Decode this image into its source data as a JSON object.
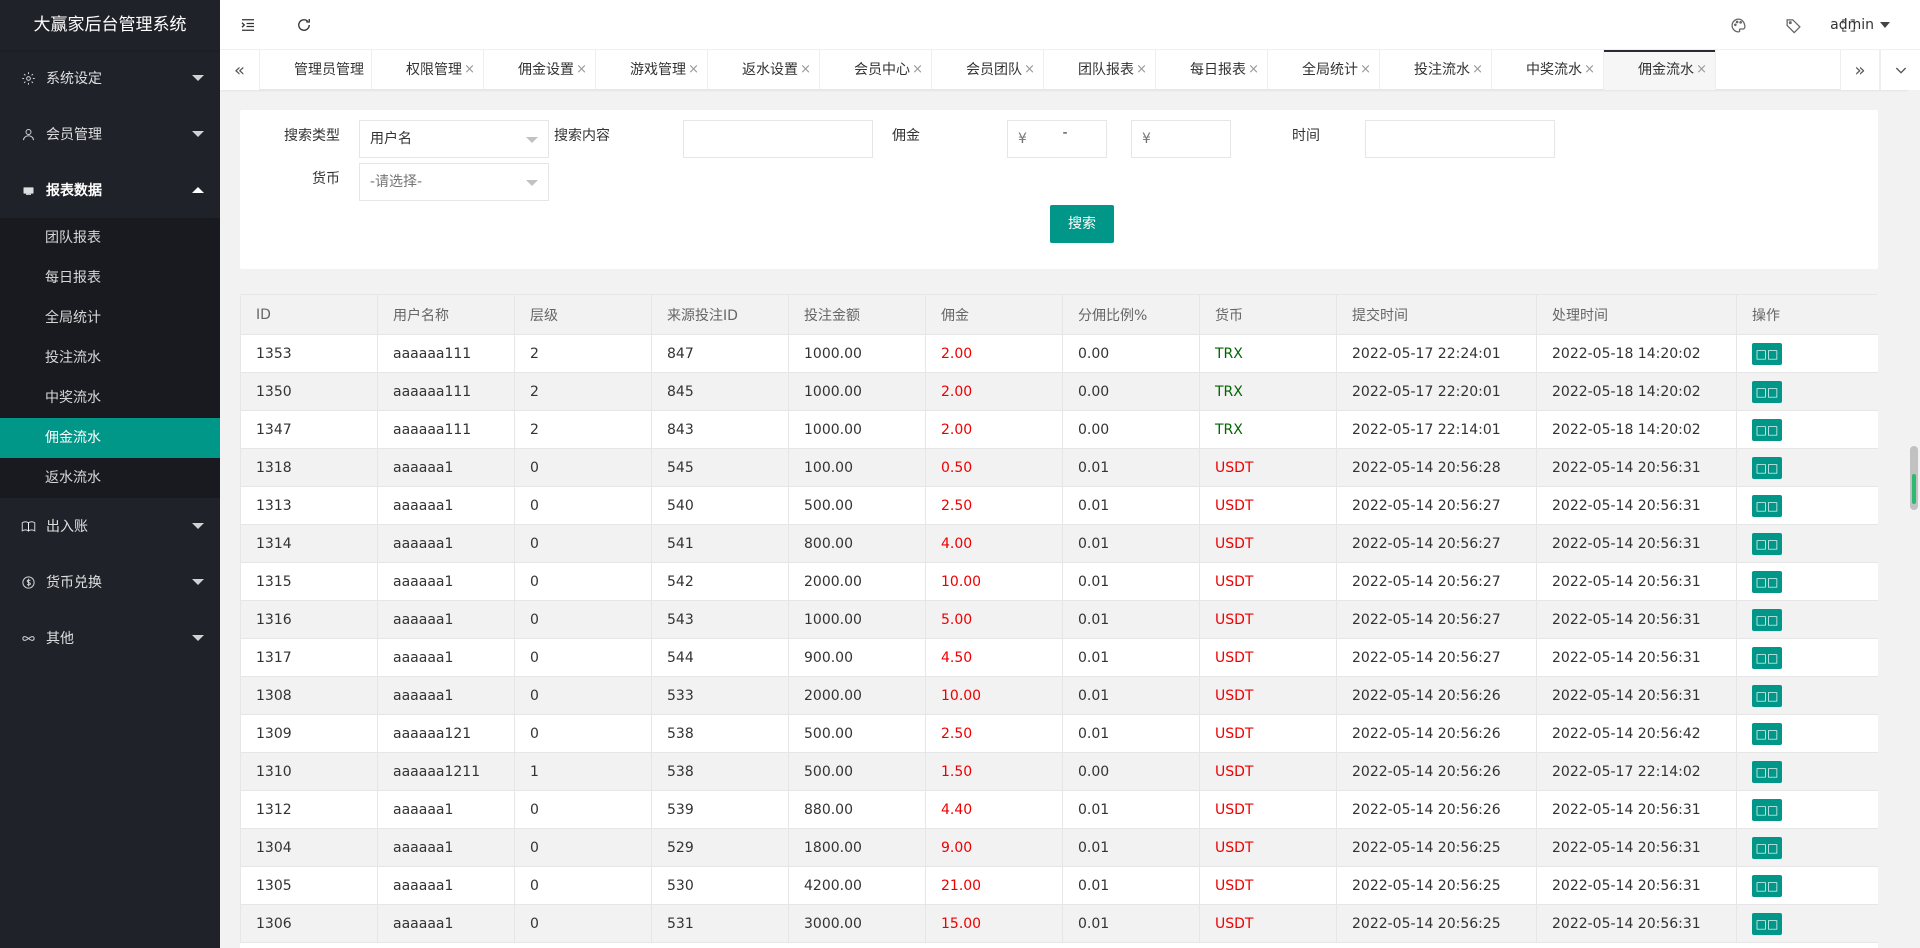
{
  "app": {
    "title": "大赢家后台管理系统"
  },
  "sidebar": {
    "items": [
      {
        "label": "系统设定",
        "icon": "gear-icon"
      },
      {
        "label": "会员管理",
        "icon": "user-icon"
      },
      {
        "label": "报表数据",
        "icon": "report-icon"
      },
      {
        "label": "出入账",
        "icon": "book-icon"
      },
      {
        "label": "货币兑换",
        "icon": "dollar-icon"
      },
      {
        "label": "其他",
        "icon": "infinity-icon"
      }
    ],
    "report_children": [
      "团队报表",
      "每日报表",
      "全局统计",
      "投注流水",
      "中奖流水",
      "佣金流水",
      "返水流水"
    ]
  },
  "header": {
    "user": "admin"
  },
  "tabs": [
    "管理员管理",
    "权限管理",
    "佣金设置",
    "游戏管理",
    "返水设置",
    "会员中心",
    "会员团队",
    "团队报表",
    "每日报表",
    "全局统计",
    "投注流水",
    "中奖流水",
    "佣金流水"
  ],
  "search": {
    "type_label": "搜索类型",
    "type_value": "用户名",
    "content_label": "搜索内容",
    "commission_label": "佣金",
    "currency_symbol": "¥",
    "dash": "-",
    "time_label": "时间",
    "currency_label": "货币",
    "currency_placeholder": "-请选择-",
    "button": "搜索"
  },
  "table": {
    "headers": [
      "ID",
      "用户名称",
      "层级",
      "来源投注ID",
      "投注金额",
      "佣金",
      "分佣比例%",
      "货币",
      "提交时间",
      "处理时间",
      "操作"
    ],
    "op_label": "□□",
    "rows": [
      [
        "1353",
        "aaaaaa111",
        "2",
        "847",
        "1000.00",
        "2.00",
        "0.00",
        "TRX",
        "2022-05-17 22:24:01",
        "2022-05-18 14:20:02"
      ],
      [
        "1350",
        "aaaaaa111",
        "2",
        "845",
        "1000.00",
        "2.00",
        "0.00",
        "TRX",
        "2022-05-17 22:20:01",
        "2022-05-18 14:20:02"
      ],
      [
        "1347",
        "aaaaaa111",
        "2",
        "843",
        "1000.00",
        "2.00",
        "0.00",
        "TRX",
        "2022-05-17 22:14:01",
        "2022-05-18 14:20:02"
      ],
      [
        "1318",
        "aaaaaa1",
        "0",
        "545",
        "100.00",
        "0.50",
        "0.01",
        "USDT",
        "2022-05-14 20:56:28",
        "2022-05-14 20:56:31"
      ],
      [
        "1313",
        "aaaaaa1",
        "0",
        "540",
        "500.00",
        "2.50",
        "0.01",
        "USDT",
        "2022-05-14 20:56:27",
        "2022-05-14 20:56:31"
      ],
      [
        "1314",
        "aaaaaa1",
        "0",
        "541",
        "800.00",
        "4.00",
        "0.01",
        "USDT",
        "2022-05-14 20:56:27",
        "2022-05-14 20:56:31"
      ],
      [
        "1315",
        "aaaaaa1",
        "0",
        "542",
        "2000.00",
        "10.00",
        "0.01",
        "USDT",
        "2022-05-14 20:56:27",
        "2022-05-14 20:56:31"
      ],
      [
        "1316",
        "aaaaaa1",
        "0",
        "543",
        "1000.00",
        "5.00",
        "0.01",
        "USDT",
        "2022-05-14 20:56:27",
        "2022-05-14 20:56:31"
      ],
      [
        "1317",
        "aaaaaa1",
        "0",
        "544",
        "900.00",
        "4.50",
        "0.01",
        "USDT",
        "2022-05-14 20:56:27",
        "2022-05-14 20:56:31"
      ],
      [
        "1308",
        "aaaaaa1",
        "0",
        "533",
        "2000.00",
        "10.00",
        "0.01",
        "USDT",
        "2022-05-14 20:56:26",
        "2022-05-14 20:56:31"
      ],
      [
        "1309",
        "aaaaaa121",
        "0",
        "538",
        "500.00",
        "2.50",
        "0.01",
        "USDT",
        "2022-05-14 20:56:26",
        "2022-05-14 20:56:42"
      ],
      [
        "1310",
        "aaaaaa1211",
        "1",
        "538",
        "500.00",
        "1.50",
        "0.00",
        "USDT",
        "2022-05-14 20:56:26",
        "2022-05-17 22:14:02"
      ],
      [
        "1312",
        "aaaaaa1",
        "0",
        "539",
        "880.00",
        "4.40",
        "0.01",
        "USDT",
        "2022-05-14 20:56:26",
        "2022-05-14 20:56:31"
      ],
      [
        "1304",
        "aaaaaa1",
        "0",
        "529",
        "1800.00",
        "9.00",
        "0.01",
        "USDT",
        "2022-05-14 20:56:25",
        "2022-05-14 20:56:31"
      ],
      [
        "1305",
        "aaaaaa1",
        "0",
        "530",
        "4200.00",
        "21.00",
        "0.01",
        "USDT",
        "2022-05-14 20:56:25",
        "2022-05-14 20:56:31"
      ],
      [
        "1306",
        "aaaaaa1",
        "0",
        "531",
        "3000.00",
        "15.00",
        "0.01",
        "USDT",
        "2022-05-14 20:56:25",
        "2022-05-14 20:56:31"
      ]
    ]
  },
  "colors": {
    "accent": "#009688",
    "sidebar_bg": "#20222a",
    "commission_red": "#e00000",
    "trx_green": "#006600",
    "usdt_red": "#e00000"
  }
}
